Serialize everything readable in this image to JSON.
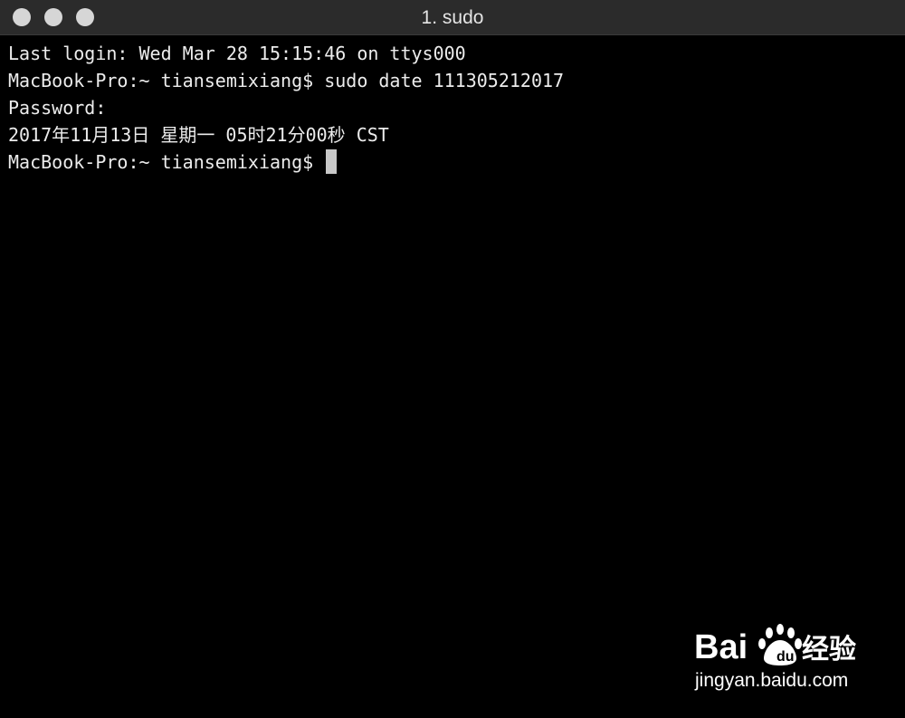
{
  "window": {
    "title": "1. sudo"
  },
  "terminal": {
    "lines": [
      "Last login: Wed Mar 28 15:15:46 on ttys000",
      "MacBook-Pro:~ tiansemixiang$ sudo date 111305212017",
      "Password:",
      "2017年11月13日 星期一 05时21分00秒 CST"
    ],
    "prompt": "MacBook-Pro:~ tiansemixiang$ "
  },
  "watermark": {
    "logo_text": "Bai 经验",
    "url": "jingyan.baidu.com"
  },
  "colors": {
    "background": "#000000",
    "titlebar": "#2b2b2b",
    "text": "#ececec",
    "cursor": "#c8c8c8"
  }
}
